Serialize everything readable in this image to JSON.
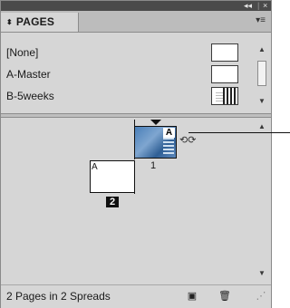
{
  "titlebar": {
    "collapse_icon": "double-chevron-left-icon",
    "collapse_glyph": "◂◂",
    "close_icon": "close-icon",
    "close_glyph": "×"
  },
  "panel": {
    "tab_label": "PAGES",
    "tab_arrows_glyph": "⬍",
    "menu_glyph": "▾≡"
  },
  "masters": {
    "items": [
      {
        "label": "[None]",
        "thumb": "blank"
      },
      {
        "label": "A-Master",
        "thumb": "blank"
      },
      {
        "label": "B-5weeks",
        "thumb": "pattern"
      }
    ]
  },
  "pages": {
    "items": [
      {
        "number": "1",
        "master_prefix": "A",
        "thumbnail": "photo-blue"
      },
      {
        "number": "2",
        "master_prefix": "A",
        "thumbnail": "blank",
        "selected": true
      }
    ],
    "rotate_glyph": "⟲⟳"
  },
  "scroll": {
    "up_glyph": "▲",
    "down_glyph": "▼"
  },
  "footer": {
    "status": "2 Pages in 2 Spreads",
    "new_page_glyph": "▣",
    "delete_glyph": "🗑",
    "grip_glyph": "⋰"
  }
}
